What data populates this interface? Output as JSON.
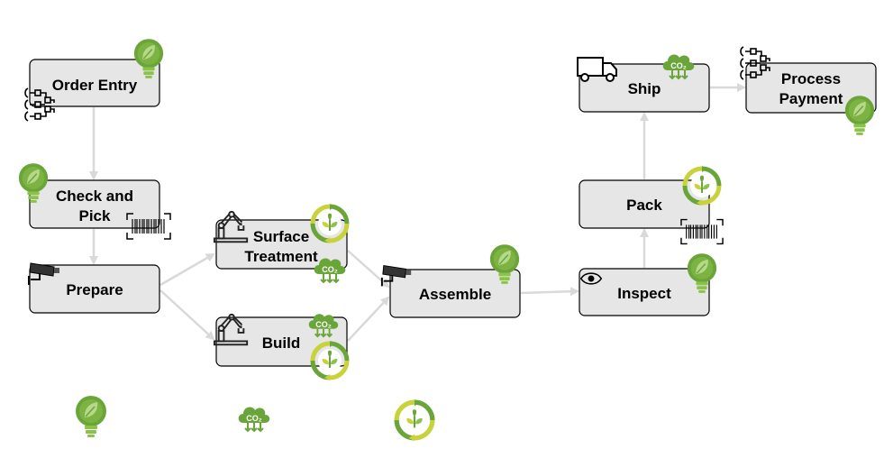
{
  "colors": {
    "node_fill": "#e6e6e6",
    "edge": "#d9d9d9",
    "green": "#6aa53a",
    "lime": "#c8d23a"
  },
  "nodes": {
    "order_entry": {
      "label": "Order Entry",
      "icons": [
        "circuit-icon",
        "bulb-leaf-icon"
      ]
    },
    "check_pick": {
      "line1": "Check and",
      "line2": "Pick",
      "icons": [
        "bulb-leaf-icon",
        "barcode-icon"
      ]
    },
    "prepare": {
      "label": "Prepare",
      "icons": [
        "camera-icon"
      ]
    },
    "surface": {
      "line1": "Surface",
      "line2": "Treatment",
      "icons": [
        "robot-arm-icon",
        "recycle-leaf-icon",
        "co2-cloud-icon"
      ]
    },
    "build": {
      "label": "Build",
      "icons": [
        "robot-arm-icon",
        "co2-cloud-icon",
        "recycle-leaf-icon"
      ]
    },
    "assemble": {
      "label": "Assemble",
      "icons": [
        "camera-icon",
        "bulb-leaf-icon"
      ]
    },
    "inspect": {
      "label": "Inspect",
      "icons": [
        "eye-icon",
        "bulb-leaf-icon"
      ]
    },
    "pack": {
      "label": "Pack",
      "icons": [
        "recycle-leaf-icon",
        "barcode-icon"
      ]
    },
    "ship": {
      "label": "Ship",
      "icons": [
        "truck-icon",
        "co2-cloud-icon"
      ]
    },
    "payment": {
      "line1": "Process",
      "line2": "Payment",
      "icons": [
        "circuit-icon",
        "bulb-leaf-icon"
      ]
    }
  },
  "legend_icons": [
    "bulb-leaf-icon",
    "co2-cloud-icon",
    "recycle-leaf-icon"
  ],
  "co2_text": "CO₂"
}
